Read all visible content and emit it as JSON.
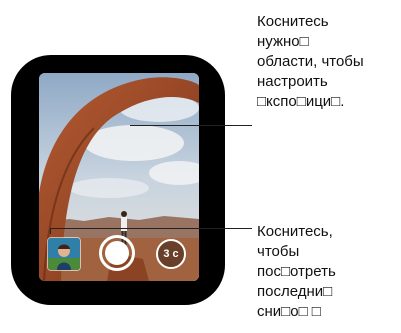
{
  "callouts": {
    "exposure": {
      "lines": [
        "Коснитесь",
        "нужно□",
        "области, чтобы",
        "настроить",
        "□кспо□ици□."
      ]
    },
    "last_photo": {
      "lines": [
        "Коснитесь,",
        "чтобы",
        "пос□отреть",
        "последни□",
        "сни□о□ □"
      ]
    }
  },
  "camera": {
    "timer_label": "3 c",
    "icons": {
      "shutter": "shutter-icon",
      "timer": "timer-3s-icon",
      "thumbnail": "last-photo-thumbnail"
    }
  }
}
